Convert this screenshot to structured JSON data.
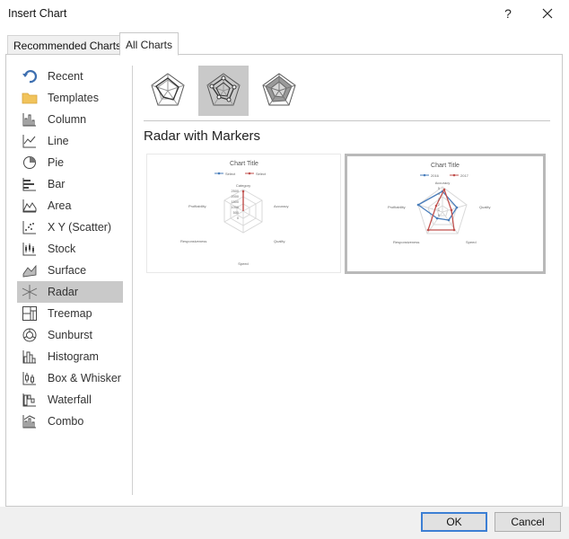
{
  "window": {
    "title": "Insert Chart",
    "help_label": "?"
  },
  "tabs": [
    {
      "label": "Recommended Charts",
      "active": false
    },
    {
      "label": "All Charts",
      "active": true
    }
  ],
  "sidebar": {
    "items": [
      {
        "label": "Recent",
        "icon": "recent-icon"
      },
      {
        "label": "Templates",
        "icon": "folder-icon"
      },
      {
        "label": "Column",
        "icon": "column-chart-icon"
      },
      {
        "label": "Line",
        "icon": "line-chart-icon"
      },
      {
        "label": "Pie",
        "icon": "pie-chart-icon"
      },
      {
        "label": "Bar",
        "icon": "bar-chart-icon"
      },
      {
        "label": "Area",
        "icon": "area-chart-icon"
      },
      {
        "label": "X Y (Scatter)",
        "icon": "scatter-chart-icon"
      },
      {
        "label": "Stock",
        "icon": "stock-chart-icon"
      },
      {
        "label": "Surface",
        "icon": "surface-chart-icon"
      },
      {
        "label": "Radar",
        "icon": "radar-chart-icon",
        "selected": true
      },
      {
        "label": "Treemap",
        "icon": "treemap-chart-icon"
      },
      {
        "label": "Sunburst",
        "icon": "sunburst-chart-icon"
      },
      {
        "label": "Histogram",
        "icon": "histogram-chart-icon"
      },
      {
        "label": "Box & Whisker",
        "icon": "box-whisker-chart-icon"
      },
      {
        "label": "Waterfall",
        "icon": "waterfall-chart-icon"
      },
      {
        "label": "Combo",
        "icon": "combo-chart-icon"
      }
    ]
  },
  "subtypes": [
    {
      "icon": "radar-icon",
      "selected": false
    },
    {
      "icon": "radar-with-markers-icon",
      "selected": true
    },
    {
      "icon": "filled-radar-icon",
      "selected": false
    }
  ],
  "selected_subtype_name": "Radar with Markers",
  "previews": [
    {
      "title": "Chart Title",
      "legend": [
        "Select",
        "Select"
      ],
      "axes": [
        "Category",
        "Accuracy",
        "Quality",
        "Speed",
        "Responsiveness",
        "Profitability"
      ],
      "ticks": [
        "2500",
        "2000",
        "1500",
        "1000",
        "500",
        "0"
      ]
    },
    {
      "title": "Chart Title",
      "legend": [
        "2016",
        "2017"
      ],
      "axes": [
        "Accuracy",
        "Quality",
        "Speed",
        "Responsiveness",
        "Profitability"
      ],
      "ticks": [
        "5",
        "4",
        "3",
        "2",
        "1",
        "0"
      ]
    }
  ],
  "colors": {
    "series1": "#4a7ebb",
    "series2": "#c0504d",
    "selected_bg": "#c9c9c9",
    "ok_border": "#3c7fd4"
  },
  "buttons": {
    "ok": "OK",
    "cancel": "Cancel"
  }
}
